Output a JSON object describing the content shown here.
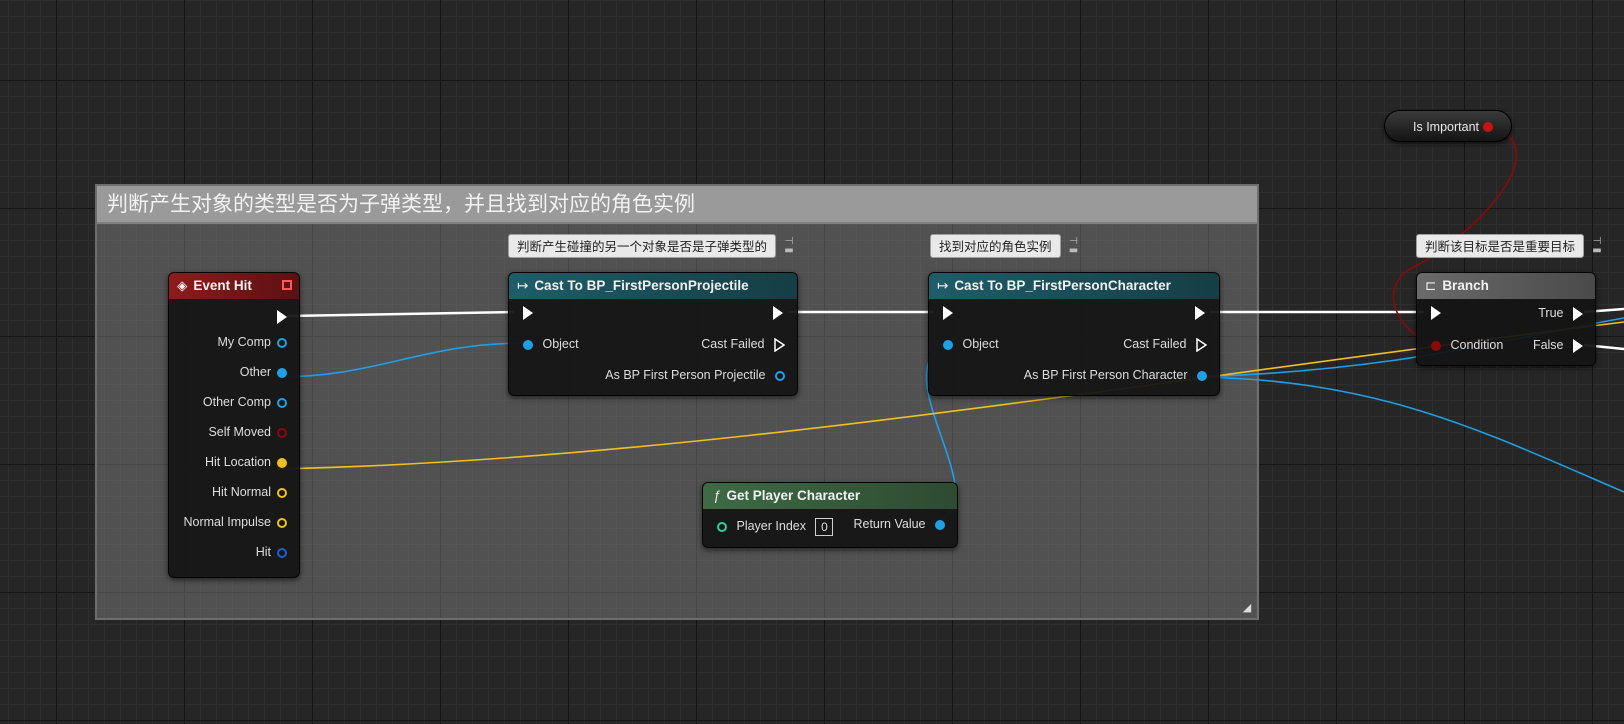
{
  "comment": {
    "title": "判断产生对象的类型是否为子弹类型，并且找到对应的角色实例"
  },
  "bubbles": {
    "cast_projectile": "判断产生碰撞的另一个对象是否是子弹类型的",
    "cast_character": "找到对应的角色实例",
    "branch": "判断该目标是否是重要目标"
  },
  "variable_node": {
    "label": "Is Important",
    "pin_color": "#c81414"
  },
  "event_hit": {
    "title": "Event Hit",
    "pins": [
      {
        "label": "My Comp",
        "color": "#1f9fe6",
        "style": "hollow"
      },
      {
        "label": "Other",
        "color": "#1f9fe6",
        "style": "filled"
      },
      {
        "label": "Other Comp",
        "color": "#1f9fe6",
        "style": "hollow"
      },
      {
        "label": "Self Moved",
        "color": "#8a0a0a",
        "style": "hollow"
      },
      {
        "label": "Hit Location",
        "color": "#f2c01e",
        "style": "filled"
      },
      {
        "label": "Hit Normal",
        "color": "#f2c01e",
        "style": "hollow"
      },
      {
        "label": "Normal Impulse",
        "color": "#f2c01e",
        "style": "hollow"
      },
      {
        "label": "Hit",
        "color": "#1a5fcc",
        "style": "hollow"
      }
    ]
  },
  "cast_projectile": {
    "title": "Cast To BP_FirstPersonProjectile",
    "object_label": "Object",
    "cast_failed_label": "Cast Failed",
    "output_label": "As BP First Person Projectile"
  },
  "cast_character": {
    "title": "Cast To BP_FirstPersonCharacter",
    "object_label": "Object",
    "cast_failed_label": "Cast Failed",
    "output_label": "As BP First Person Character"
  },
  "get_player_character": {
    "title": "Get Player Character",
    "player_index_label": "Player Index",
    "player_index_value": "0",
    "return_label": "Return Value"
  },
  "branch": {
    "title": "Branch",
    "condition_label": "Condition",
    "true_label": "True",
    "false_label": "False"
  },
  "colors": {
    "exec_wire": "#ffffff",
    "object_wire": "#1f9fe6",
    "vector_wire": "#f2c01e",
    "bool_wire": "#8a0a0a"
  }
}
